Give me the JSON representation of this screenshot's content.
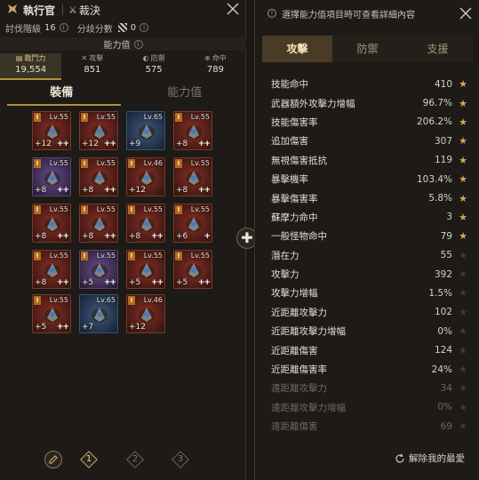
{
  "left_panel": {
    "header": {
      "class_name": "執行官",
      "skill_name": "裁決"
    },
    "subheader": {
      "conquest_label": "討伐階級",
      "conquest_value": "16",
      "divergence_label": "分歧分數",
      "divergence_value": "0"
    },
    "ability_bar_label": "能力值",
    "stats": [
      {
        "label": "戰鬥力",
        "value": "19,554"
      },
      {
        "label": "攻擊",
        "value": "851"
      },
      {
        "label": "防禦",
        "value": "575"
      },
      {
        "label": "命中",
        "value": "789"
      }
    ],
    "tabs": [
      {
        "label": "裝備"
      },
      {
        "label": "能力值"
      }
    ],
    "equipment": [
      {
        "lv": "Lv.55",
        "enh": "+12",
        "double_plus": "++",
        "badge": "!",
        "color": "red"
      },
      {
        "lv": "Lv.55",
        "enh": "+12",
        "double_plus": "++",
        "badge": "!",
        "color": "red"
      },
      {
        "lv": "Lv.65",
        "enh": "+9",
        "double_plus": "",
        "badge": "",
        "color": "blue"
      },
      {
        "lv": "Lv.55",
        "enh": "+8",
        "double_plus": "++",
        "badge": "!",
        "color": "red"
      },
      {
        "lv": "Lv.55",
        "enh": "+8",
        "double_plus": "++",
        "badge": "!",
        "color": "purple"
      },
      {
        "lv": "Lv.55",
        "enh": "+8",
        "double_plus": "++",
        "badge": "!",
        "color": "red"
      },
      {
        "lv": "Lv.46",
        "enh": "+12",
        "double_plus": "",
        "badge": "!",
        "color": "red"
      },
      {
        "lv": "Lv.55",
        "enh": "+8",
        "double_plus": "++",
        "badge": "!",
        "color": "red"
      },
      {
        "lv": "Lv.55",
        "enh": "+8",
        "double_plus": "++",
        "badge": "!",
        "color": "red"
      },
      {
        "lv": "Lv.55",
        "enh": "+8",
        "double_plus": "++",
        "badge": "!",
        "color": "red"
      },
      {
        "lv": "Lv.55",
        "enh": "+8",
        "double_plus": "++",
        "badge": "!",
        "color": "red"
      },
      {
        "lv": "Lv.55",
        "enh": "+6",
        "double_plus": "+",
        "badge": "!",
        "color": "red"
      },
      {
        "lv": "Lv.55",
        "enh": "+8",
        "double_plus": "++",
        "badge": "!",
        "color": "red"
      },
      {
        "lv": "Lv.55",
        "enh": "+5",
        "double_plus": "++",
        "badge": "!",
        "color": "purple"
      },
      {
        "lv": "Lv.55",
        "enh": "+5",
        "double_plus": "++",
        "badge": "!",
        "color": "red"
      },
      {
        "lv": "Lv.55",
        "enh": "+5",
        "double_plus": "++",
        "badge": "!",
        "color": "red"
      },
      {
        "lv": "Lv.55",
        "enh": "+5",
        "double_plus": "++",
        "badge": "!",
        "color": "red"
      },
      {
        "lv": "Lv.65",
        "enh": "+7",
        "double_plus": "",
        "badge": "",
        "color": "blue"
      },
      {
        "lv": "Lv.46",
        "enh": "+12",
        "double_plus": "",
        "badge": "!",
        "color": "red"
      }
    ],
    "pages": [
      "1",
      "2",
      "3"
    ],
    "active_page": "1"
  },
  "right_panel": {
    "hint": "選擇能力值項目時可查看詳細內容",
    "tabs": [
      {
        "label": "攻擊"
      },
      {
        "label": "防禦"
      },
      {
        "label": "支援"
      }
    ],
    "stats": [
      {
        "name": "技能命中",
        "value": "410",
        "starred": true,
        "dim": false
      },
      {
        "name": "武器額外攻擊力增幅",
        "value": "96.7%",
        "starred": true,
        "dim": false
      },
      {
        "name": "技能傷害率",
        "value": "206.2%",
        "starred": true,
        "dim": false
      },
      {
        "name": "追加傷害",
        "value": "307",
        "starred": true,
        "dim": false
      },
      {
        "name": "無視傷害抵抗",
        "value": "119",
        "starred": true,
        "dim": false
      },
      {
        "name": "暴擊機率",
        "value": "103.4%",
        "starred": true,
        "dim": false
      },
      {
        "name": "暴擊傷害率",
        "value": "5.8%",
        "starred": true,
        "dim": false
      },
      {
        "name": "蘇摩力命中",
        "value": "3",
        "starred": true,
        "dim": false
      },
      {
        "name": "一般怪物命中",
        "value": "79",
        "starred": true,
        "dim": false
      },
      {
        "name": "潛在力",
        "value": "55",
        "starred": false,
        "dim": false
      },
      {
        "name": "攻擊力",
        "value": "392",
        "starred": false,
        "dim": false
      },
      {
        "name": "攻擊力增幅",
        "value": "1.5%",
        "starred": false,
        "dim": false
      },
      {
        "name": "近距離攻擊力",
        "value": "102",
        "starred": false,
        "dim": false
      },
      {
        "name": "近距離攻擊力增幅",
        "value": "0%",
        "starred": false,
        "dim": false
      },
      {
        "name": "近距離傷害",
        "value": "124",
        "starred": false,
        "dim": false
      },
      {
        "name": "近距離傷害率",
        "value": "24%",
        "starred": false,
        "dim": false
      },
      {
        "name": "遠距離攻擊力",
        "value": "34",
        "starred": false,
        "dim": true
      },
      {
        "name": "遠距離攻擊力增幅",
        "value": "0%",
        "starred": false,
        "dim": true
      },
      {
        "name": "遠距離傷害",
        "value": "69",
        "starred": false,
        "dim": true
      }
    ],
    "unfavorite_label": "解除我的最愛"
  }
}
